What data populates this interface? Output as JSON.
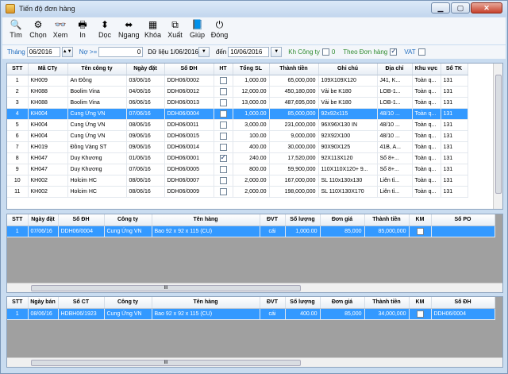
{
  "window": {
    "title": "Tiến độ đơn hàng"
  },
  "toolbar": [
    {
      "label": "Tìm",
      "icon": "search-icon",
      "glyph": "🔍"
    },
    {
      "label": "Chọn",
      "icon": "gear-icon",
      "glyph": "⚙"
    },
    {
      "label": "Xem",
      "icon": "view-icon",
      "glyph": "👓"
    },
    {
      "label": "In",
      "icon": "printer-icon",
      "glyph": "🖶"
    },
    {
      "label": "Dọc",
      "icon": "vertical-arrows-icon",
      "glyph": "⬍"
    },
    {
      "label": "Ngang",
      "icon": "horizontal-arrows-icon",
      "glyph": "⬌"
    },
    {
      "label": "Khóa",
      "icon": "lock-icon",
      "glyph": "▦"
    },
    {
      "label": "Xuất",
      "icon": "export-icon",
      "glyph": "⧉"
    },
    {
      "label": "Giúp",
      "icon": "help-book-icon",
      "glyph": "📘"
    },
    {
      "label": "Đóng",
      "icon": "power-icon",
      "glyph": "⏻"
    }
  ],
  "filter": {
    "thang_label": "Tháng",
    "thang_value": "06/2016",
    "no_label": "Nợ >=",
    "no_value": "0",
    "dulieu_label": "Dữ liệu 1/06/2016",
    "den_label": "đến",
    "den_value": "10/06/2016",
    "khcongty_label": "Kh Công ty",
    "khcongty_value": "0",
    "theodon_label": "Theo Đơn hàng",
    "vat_label": "VAT"
  },
  "grid1": {
    "headers": [
      "STT",
      "Mã CTy",
      "Tên công ty",
      "Ngày đặt",
      "Số ĐH",
      "HT",
      "Tổng SL",
      "Thành tiền",
      "Ghi chú",
      "Địa chỉ",
      "Khu vực",
      "Số TK"
    ],
    "rows": [
      [
        "1",
        "KH009",
        "An Đông",
        "03/06/16",
        "DDH06/0002",
        false,
        "1,000.00",
        "65,000,000",
        "109X109X120",
        "J41, K...",
        "Toàn q...",
        "131"
      ],
      [
        "2",
        "KH088",
        "Boolim Vina",
        "04/06/16",
        "DDH06/0012",
        false,
        "12,000.00",
        "450,180,000",
        "Vải be K180",
        "LOB-1...",
        "Toàn q...",
        "131"
      ],
      [
        "3",
        "KH088",
        "Boolim Vina",
        "06/06/16",
        "DDH06/0013",
        false,
        "13,000.00",
        "487,695,000",
        "Vải be K180",
        "LOB-1...",
        "Toàn q...",
        "131"
      ],
      [
        "4",
        "KH004",
        "Cung Ứng VN",
        "07/06/16",
        "DDH06/0004",
        false,
        "1,000.00",
        "85,000,000",
        "92x92x115",
        "48/10 ...",
        "Toàn q...",
        "131"
      ],
      [
        "5",
        "KH004",
        "Cung Ứng VN",
        "08/06/16",
        "DDH06/0011",
        false,
        "3,000.00",
        "231,000,000",
        "96X96X130 IN",
        "48/10 ...",
        "Toàn q...",
        "131"
      ],
      [
        "6",
        "KH004",
        "Cung Ứng VN",
        "09/06/16",
        "DDH06/0015",
        false,
        "100.00",
        "9,000,000",
        "92X92X100",
        "48/10 ...",
        "Toàn q...",
        "131"
      ],
      [
        "7",
        "KH019",
        "Đồng Vàng ST",
        "09/06/16",
        "DDH06/0014",
        false,
        "400.00",
        "30,000,000",
        "90X90X125",
        "41B, A...",
        "Toàn q...",
        "131"
      ],
      [
        "8",
        "KH047",
        "Duy Khương",
        "01/06/16",
        "DDH06/0001",
        true,
        "240.00",
        "17,520,000",
        "92X113X120",
        "Số 8+...",
        "Toàn q...",
        "131"
      ],
      [
        "9",
        "KH047",
        "Duy Khương",
        "07/06/16",
        "DDH06/0005",
        false,
        "800.00",
        "59,900,000",
        "110X110X120+ 9...",
        "Số 8+...",
        "Toàn q...",
        "131"
      ],
      [
        "10",
        "KH002",
        "Holcim HC",
        "08/06/16",
        "DDH06/0007",
        false,
        "2,000.00",
        "167,000,000",
        "SL 110x130x130",
        "Liên tỉ...",
        "Toàn q...",
        "131"
      ],
      [
        "11",
        "KH002",
        "Holcim HC",
        "08/06/16",
        "DDH06/0009",
        false,
        "2,000.00",
        "198,000,000",
        "SL 110X130X170",
        "Liên tỉ...",
        "Toàn q...",
        "131"
      ]
    ],
    "selected": 3
  },
  "grid2": {
    "headers": [
      "STT",
      "Ngày đặt",
      "Số ĐH",
      "Công ty",
      "Tên hàng",
      "ĐVT",
      "Số lượng",
      "Đơn giá",
      "Thành tiền",
      "KM",
      "Số PO"
    ],
    "rows": [
      [
        "1",
        "07/06/16",
        "DDH06/0004",
        "Cung Ứng VN",
        "Bao 92 x 92 x 115 (CU)",
        "cái",
        "1,000.00",
        "85,000",
        "85,000,000",
        false,
        ""
      ]
    ]
  },
  "grid3": {
    "headers": [
      "STT",
      "Ngày bán",
      "Số CT",
      "Công ty",
      "Tên hàng",
      "ĐVT",
      "Số lượng",
      "Đơn giá",
      "Thành tiền",
      "KM",
      "Số ĐH"
    ],
    "rows": [
      [
        "1",
        "08/06/16",
        "HDBH06/1923",
        "Cung Ứng VN",
        "Bao 92 x 92 x 115 (CU)",
        "cái",
        "400.00",
        "85,000",
        "34,000,000",
        false,
        "DDH06/0004"
      ]
    ]
  },
  "scroll": {
    "thumb_label": "III"
  }
}
